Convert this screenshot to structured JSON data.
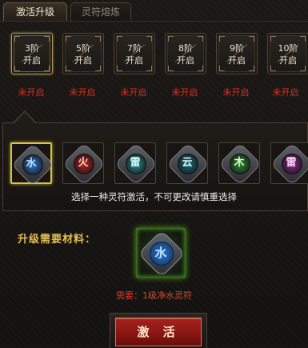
{
  "tabs": [
    {
      "label": "激活升级"
    },
    {
      "label": "灵符熔炼"
    }
  ],
  "stages": [
    {
      "level": "3",
      "unit": "阶",
      "state": "开启",
      "status": "未开启"
    },
    {
      "level": "5",
      "unit": "阶",
      "state": "开启",
      "status": "未开启"
    },
    {
      "level": "7",
      "unit": "阶",
      "state": "开启",
      "status": "未开启"
    },
    {
      "level": "8",
      "unit": "阶",
      "state": "开启",
      "status": "未开启"
    },
    {
      "level": "9",
      "unit": "阶",
      "state": "开启",
      "status": "未开启"
    },
    {
      "level": "10",
      "unit": "阶",
      "state": "开启",
      "status": "未开启"
    }
  ],
  "runes": [
    {
      "glyph": "水",
      "icon": "water-rune-icon",
      "color": "#2e76c6",
      "glyph_color": "#bfe6ff"
    },
    {
      "glyph": "火",
      "icon": "fire-rune-icon",
      "color": "#b22620",
      "glyph_color": "#ffd1c4"
    },
    {
      "glyph": "雷",
      "icon": "thunder-rune-icon",
      "color": "#2f8a8e",
      "glyph_color": "#d0ffff"
    },
    {
      "glyph": "云",
      "icon": "cloud-rune-icon",
      "color": "#1f6c78",
      "glyph_color": "#d4f7ff"
    },
    {
      "glyph": "木",
      "icon": "wood-rune-icon",
      "color": "#2f8a34",
      "glyph_color": "#d6ffcd"
    },
    {
      "glyph": "雷",
      "icon": "purple-rune-icon",
      "color": "#8a2a8e",
      "glyph_color": "#ffd2ff"
    }
  ],
  "hint": "选择一种灵符激活，不可更改请慎重选择",
  "materials": {
    "label": "升级需要材料：",
    "glyph": "水",
    "need_key": "需要：",
    "need_value": "1级净水灵符"
  },
  "activate_button": "激 活"
}
